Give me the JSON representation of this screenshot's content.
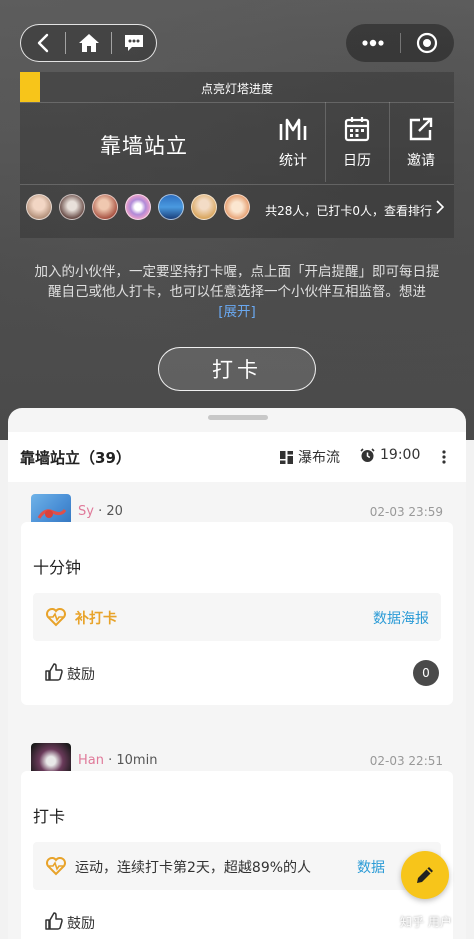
{
  "nav": {
    "back_icon": "chevron-left-icon",
    "home_icon": "home-icon",
    "chat_icon": "chat-bubble-icon",
    "more_icon": "dots-icon",
    "close_icon": "target-circle-icon"
  },
  "panel": {
    "progress_label": "点亮灯塔进度",
    "group_name": "靠墙站立",
    "actions": [
      {
        "label": "统计",
        "icon": "stats-icon"
      },
      {
        "label": "日历",
        "icon": "calendar-icon"
      },
      {
        "label": "邀请",
        "icon": "share-icon"
      }
    ],
    "members_summary": "共28人，已打卡0人，查看排行"
  },
  "intro": {
    "text": "加入的小伙伴，一定要坚持打卡喔，点上面「开启提醒」即可每日提醒自己或他人打卡，也可以任意选择一个小伙伴互相监督。想进",
    "expand": "[展开]"
  },
  "checkin_button": "打卡",
  "sheet": {
    "title": "靠墙站立（39）",
    "view_mode": "瀑布流",
    "remind_time": "19:00"
  },
  "posts": [
    {
      "user": "Sy",
      "meta_suffix": " · 20",
      "time": "02-03 23:59",
      "content": "十分钟",
      "stat_text": "补打卡",
      "stat_color": "#e8a32a",
      "poster_link": "数据海报",
      "like_label": "鼓励",
      "like_count": "0"
    },
    {
      "user": "Han",
      "meta_suffix": " · 10min",
      "time": "02-03 22:51",
      "content": "打卡",
      "stat_text": "运动，连续打卡第2天，超越89%的人",
      "stat_color": "#333333",
      "poster_link": "数据",
      "like_label": "鼓励"
    }
  ],
  "fab_icon": "pencil-icon",
  "watermark": "知乎 用户"
}
